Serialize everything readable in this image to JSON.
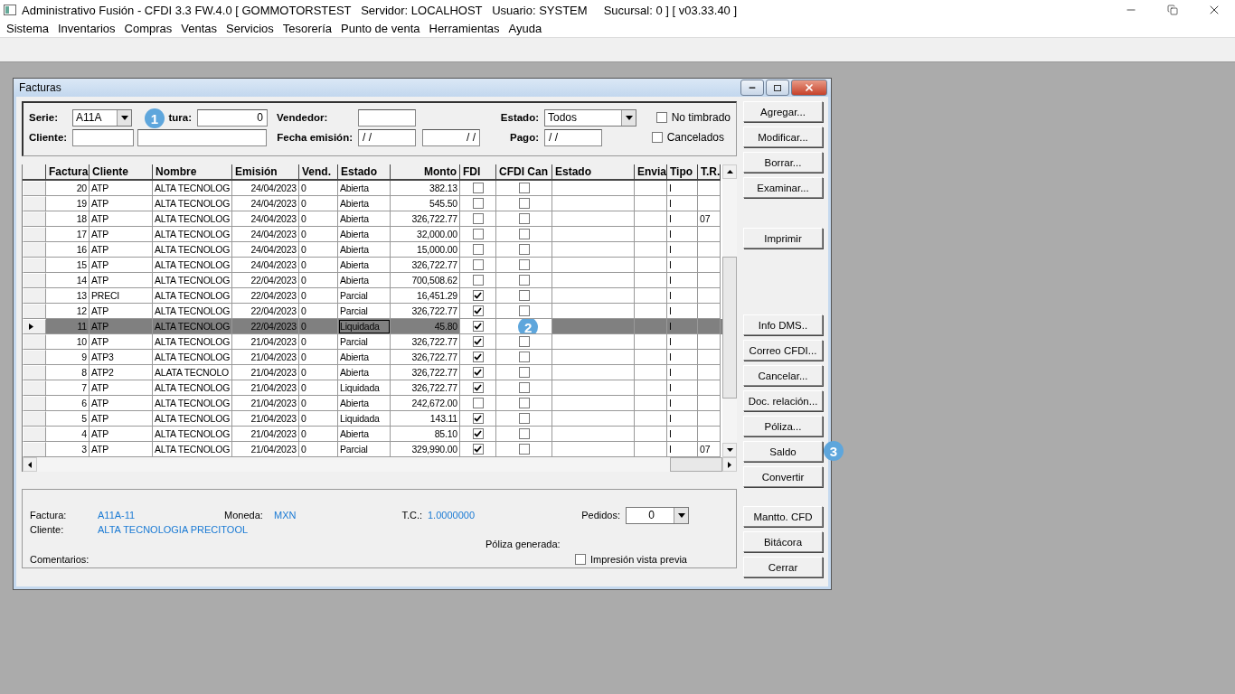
{
  "app": {
    "title": "Administrativo Fusión - CFDI 3.3 FW.4.0 [ GOMMOTORSTEST   Servidor: LOCALHOST   Usuario: SYSTEM     Sucursal: 0 ] [ v03.33.40 ]"
  },
  "menu": [
    "Sistema",
    "Inventarios",
    "Compras",
    "Ventas",
    "Servicios",
    "Tesorería",
    "Punto de venta",
    "Herramientas",
    "Ayuda"
  ],
  "window": {
    "title": "Facturas"
  },
  "filters": {
    "serie_label": "Serie:",
    "serie_value": "A11A",
    "factura_label": "tura:",
    "factura_value": "0",
    "vendedor_label": "Vendedor:",
    "estado_label": "Estado:",
    "estado_value": "Todos",
    "cliente_label": "Cliente:",
    "fecha_label": "Fecha emisión:",
    "fecha_from": "/ /",
    "fecha_to": "/ /",
    "pago_label": "Pago:",
    "pago_value": "/ /",
    "checks": [
      {
        "label": "No timbrado",
        "checked": false
      },
      {
        "label": "Cancelados",
        "checked": false
      }
    ]
  },
  "table": {
    "columns": [
      "Factura",
      "Cliente",
      "Nombre",
      "Emisión",
      "Vend.",
      "Estado",
      "Monto",
      "FDI",
      "CFDI Can",
      "Estado",
      "Envia",
      "Tipo",
      "T.R."
    ],
    "rows": [
      {
        "factura": "20",
        "cliente": "ATP",
        "nombre": "ALTA TECNOLOG",
        "emision": "24/04/2023",
        "vend": "0",
        "estado": "Abierta",
        "monto": "382.13",
        "fdi": false,
        "cfdi_can": false,
        "tipo": "I",
        "selected": false
      },
      {
        "factura": "19",
        "cliente": "ATP",
        "nombre": "ALTA TECNOLOG",
        "emision": "24/04/2023",
        "vend": "0",
        "estado": "Abierta",
        "monto": "545.50",
        "fdi": false,
        "cfdi_can": false,
        "tipo": "I",
        "selected": false
      },
      {
        "factura": "18",
        "cliente": "ATP",
        "nombre": "ALTA TECNOLOG",
        "emision": "24/04/2023",
        "vend": "0",
        "estado": "Abierta",
        "monto": "326,722.77",
        "fdi": false,
        "cfdi_can": false,
        "tipo": "I",
        "tr": "07",
        "selected": false
      },
      {
        "factura": "17",
        "cliente": "ATP",
        "nombre": "ALTA TECNOLOG",
        "emision": "24/04/2023",
        "vend": "0",
        "estado": "Abierta",
        "monto": "32,000.00",
        "fdi": false,
        "cfdi_can": false,
        "tipo": "I",
        "selected": false
      },
      {
        "factura": "16",
        "cliente": "ATP",
        "nombre": "ALTA TECNOLOG",
        "emision": "24/04/2023",
        "vend": "0",
        "estado": "Abierta",
        "monto": "15,000.00",
        "fdi": false,
        "cfdi_can": false,
        "tipo": "I",
        "selected": false
      },
      {
        "factura": "15",
        "cliente": "ATP",
        "nombre": "ALTA TECNOLOG",
        "emision": "24/04/2023",
        "vend": "0",
        "estado": "Abierta",
        "monto": "326,722.77",
        "fdi": false,
        "cfdi_can": false,
        "tipo": "I",
        "selected": false
      },
      {
        "factura": "14",
        "cliente": "ATP",
        "nombre": "ALTA TECNOLOG",
        "emision": "22/04/2023",
        "vend": "0",
        "estado": "Abierta",
        "monto": "700,508.62",
        "fdi": false,
        "cfdi_can": false,
        "tipo": "I",
        "selected": false
      },
      {
        "factura": "13",
        "cliente": "PRECI",
        "nombre": "ALTA TECNOLOG",
        "emision": "22/04/2023",
        "vend": "0",
        "estado": "Parcial",
        "monto": "16,451.29",
        "fdi": true,
        "cfdi_can": false,
        "tipo": "I",
        "selected": false
      },
      {
        "factura": "12",
        "cliente": "ATP",
        "nombre": "ALTA TECNOLOG",
        "emision": "22/04/2023",
        "vend": "0",
        "estado": "Parcial",
        "monto": "326,722.77",
        "fdi": true,
        "cfdi_can": false,
        "tipo": "I",
        "selected": false
      },
      {
        "factura": "11",
        "cliente": "ATP",
        "nombre": "ALTA TECNOLOG",
        "emision": "22/04/2023",
        "vend": "0",
        "estado": "Liquidada",
        "monto": "45.80",
        "fdi": true,
        "tipo": "I",
        "selected": true
      },
      {
        "factura": "10",
        "cliente": "ATP",
        "nombre": "ALTA TECNOLOG",
        "emision": "21/04/2023",
        "vend": "0",
        "estado": "Parcial",
        "monto": "326,722.77",
        "fdi": true,
        "cfdi_can": false,
        "tipo": "I",
        "selected": false
      },
      {
        "factura": "9",
        "cliente": "ATP3",
        "nombre": "ALTA TECNOLOG",
        "emision": "21/04/2023",
        "vend": "0",
        "estado": "Abierta",
        "monto": "326,722.77",
        "fdi": true,
        "cfdi_can": false,
        "tipo": "I",
        "selected": false
      },
      {
        "factura": "8",
        "cliente": "ATP2",
        "nombre": "ALATA TECNOLO",
        "emision": "21/04/2023",
        "vend": "0",
        "estado": "Abierta",
        "monto": "326,722.77",
        "fdi": true,
        "cfdi_can": false,
        "tipo": "I",
        "selected": false
      },
      {
        "factura": "7",
        "cliente": "ATP",
        "nombre": "ALTA TECNOLOG",
        "emision": "21/04/2023",
        "vend": "0",
        "estado": "Liquidada",
        "monto": "326,722.77",
        "fdi": true,
        "cfdi_can": false,
        "tipo": "I",
        "selected": false
      },
      {
        "factura": "6",
        "cliente": "ATP",
        "nombre": "ALTA TECNOLOG",
        "emision": "21/04/2023",
        "vend": "0",
        "estado": "Abierta",
        "monto": "242,672.00",
        "fdi": false,
        "cfdi_can": false,
        "tipo": "I",
        "selected": false
      },
      {
        "factura": "5",
        "cliente": "ATP",
        "nombre": "ALTA TECNOLOG",
        "emision": "21/04/2023",
        "vend": "0",
        "estado": "Liquidada",
        "monto": "143.11",
        "fdi": true,
        "cfdi_can": false,
        "tipo": "I",
        "selected": false
      },
      {
        "factura": "4",
        "cliente": "ATP",
        "nombre": "ALTA TECNOLOG",
        "emision": "21/04/2023",
        "vend": "0",
        "estado": "Abierta",
        "monto": "85.10",
        "fdi": true,
        "cfdi_can": false,
        "tipo": "I",
        "selected": false
      },
      {
        "factura": "3",
        "cliente": "ATP",
        "nombre": "ALTA TECNOLOG",
        "emision": "21/04/2023",
        "vend": "0",
        "estado": "Parcial",
        "monto": "329,990.00",
        "fdi": true,
        "cfdi_can": false,
        "tipo": "I",
        "tr": "07",
        "selected": false
      }
    ]
  },
  "button_groups": [
    [
      "Agregar...",
      "Modificar...",
      "Borrar...",
      "Examinar..."
    ],
    [
      "Imprimir"
    ],
    [
      "Info DMS..",
      "Correo CFDI...",
      "Cancelar...",
      "Doc. relación...",
      "Póliza...",
      "Saldo",
      "Convertir"
    ],
    [
      "Mantto. CFD",
      "Bitácora",
      "Cerrar"
    ]
  ],
  "details": {
    "factura_label": "Factura:",
    "factura_value": "A11A-11",
    "moneda_label": "Moneda:",
    "moneda_value": "MXN",
    "tc_label": "T.C.:",
    "tc_value": "1.0000000",
    "pedidos_label": "Pedidos:",
    "pedidos_value": "0",
    "cliente_label": "Cliente:",
    "cliente_value": "ALTA TECNOLOGIA PRECITOOL",
    "poliza_label": "Póliza generada:",
    "comentarios_label": "Comentarios:",
    "preview": {
      "label": "Impresión vista previa",
      "checked": false
    }
  },
  "callouts": [
    "1",
    "2",
    "3"
  ]
}
